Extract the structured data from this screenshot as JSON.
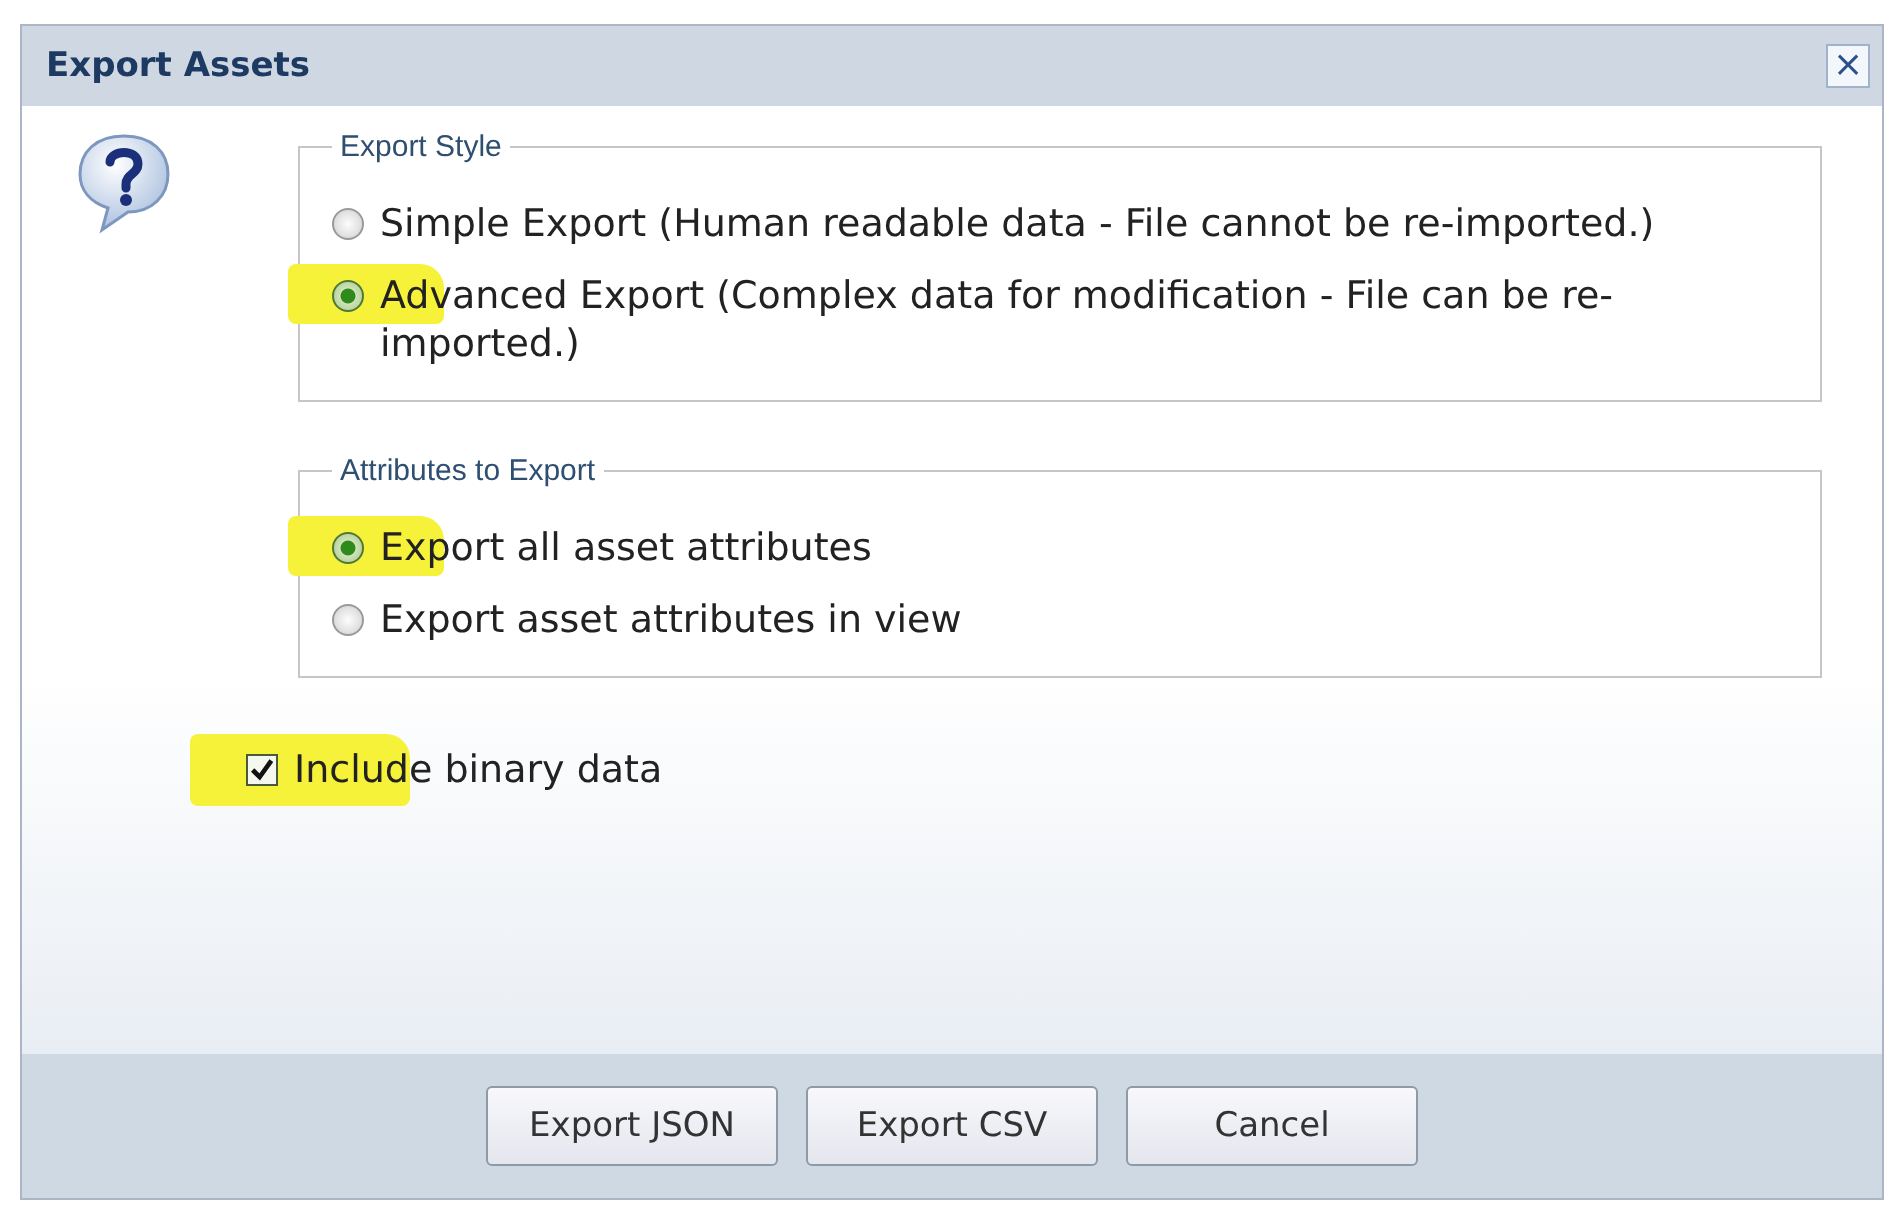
{
  "window": {
    "title": "Export Assets",
    "close": "×"
  },
  "groups": [
    {
      "legend": "Export Style",
      "options": [
        {
          "label": "Simple Export (Human readable data - File cannot be re-imported.)",
          "selected": false,
          "highlighted": false
        },
        {
          "label": "Advanced Export (Complex data for modification - File can be re-imported.)",
          "selected": true,
          "highlighted": true
        }
      ]
    },
    {
      "legend": "Attributes to Export",
      "options": [
        {
          "label": "Export all asset attributes",
          "selected": true,
          "highlighted": true
        },
        {
          "label": "Export asset attributes in view",
          "selected": false,
          "highlighted": false
        }
      ]
    }
  ],
  "checkbox": {
    "label": "Include binary data",
    "checked": true,
    "highlighted": true
  },
  "buttons": [
    "Export JSON",
    "Export CSV",
    "Cancel"
  ]
}
